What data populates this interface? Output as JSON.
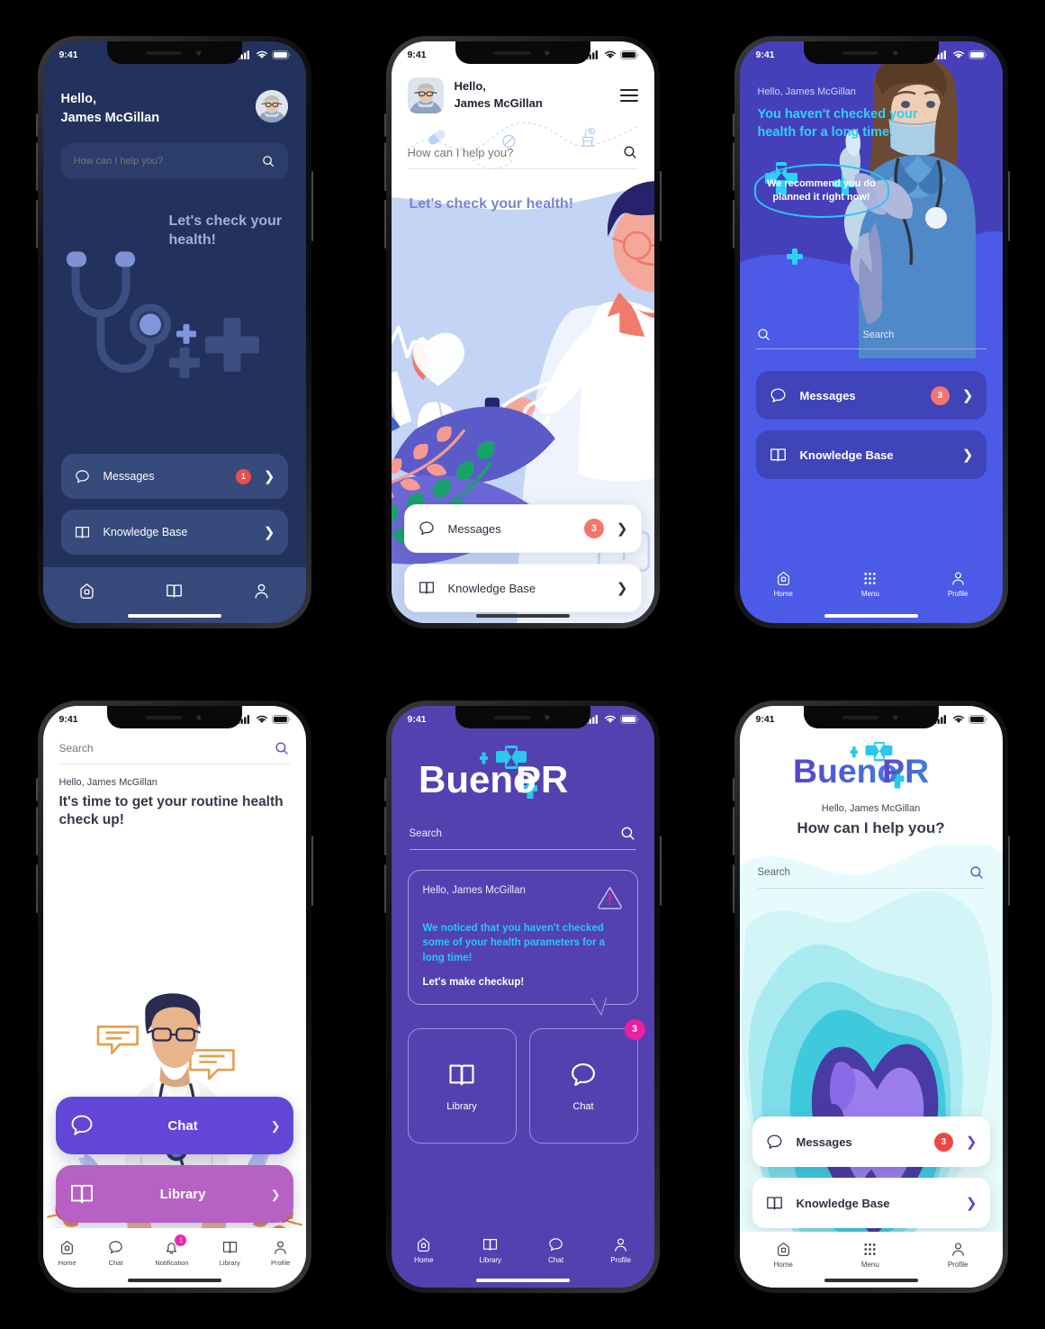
{
  "common": {
    "status_time": "9:41",
    "user_name": "James McGillan"
  },
  "colors": {
    "navy": "#22325c",
    "indigo": "#4540ba",
    "blue": "#4c5ae8",
    "purple": "#5540b0",
    "violet": "#6246d8",
    "pink": "#ec1f9e",
    "orchid": "#b761c4",
    "cyan": "#29c6f2",
    "red_badge": "#ee4b4b",
    "coral_badge": "#f4756d"
  },
  "screen1": {
    "greeting_line1": "Hello,",
    "greeting_line2": "James McGillan",
    "search_placeholder": "How can I help you?",
    "hero_title": "Let's check your health!",
    "cards": [
      {
        "label": "Messages",
        "badge": "1",
        "icon": "chat-bubble-icon"
      },
      {
        "label": "Knowledge Base",
        "badge": "",
        "icon": "book-icon"
      }
    ],
    "tabs": [
      {
        "label": "",
        "icon": "home-icon"
      },
      {
        "label": "",
        "icon": "book-icon"
      },
      {
        "label": "",
        "icon": "person-icon"
      }
    ]
  },
  "screen2": {
    "greeting_line1": "Hello,",
    "greeting_line2": "James McGillan",
    "search_placeholder": "How can I help you?",
    "hero_title": "Let's check your health!",
    "menu_icon": "hamburger-menu-icon",
    "cards": [
      {
        "label": "Messages",
        "badge": "3",
        "icon": "chat-bubble-icon"
      },
      {
        "label": "Knowledge Base",
        "badge": "",
        "icon": "book-icon"
      }
    ]
  },
  "screen3": {
    "greeting": "Hello, James McGillan",
    "headline": "You haven't checked your health for a long time.",
    "bubble": "We recommend you do planned it right now!",
    "search_placeholder": "Search",
    "cards": [
      {
        "label": "Messages",
        "badge": "3",
        "icon": "chat-bubble-icon"
      },
      {
        "label": "Knowledge Base",
        "badge": "",
        "icon": "book-icon"
      }
    ],
    "tabs": [
      {
        "label": "Home",
        "icon": "home-icon"
      },
      {
        "label": "Menu",
        "icon": "grid-dots-icon"
      },
      {
        "label": "Profile",
        "icon": "person-icon"
      }
    ]
  },
  "screen4": {
    "search_placeholder": "Search",
    "greeting": "Hello, James McGillan",
    "headline": "It's time to get your routine health check up!",
    "cards": [
      {
        "label": "Chat",
        "icon": "chat-bubble-icon",
        "color": "#6246d8"
      },
      {
        "label": "Library",
        "icon": "book-icon",
        "color": "#b761c4"
      }
    ],
    "tabs": [
      {
        "label": "Home",
        "icon": "home-icon",
        "badge": ""
      },
      {
        "label": "Chat",
        "icon": "chat-bubble-icon",
        "badge": ""
      },
      {
        "label": "Notification",
        "icon": "bell-icon",
        "badge": "1"
      },
      {
        "label": "Library",
        "icon": "book-icon",
        "badge": ""
      },
      {
        "label": "Profile",
        "icon": "person-icon",
        "badge": ""
      }
    ]
  },
  "screen5": {
    "logo_text_1": "Bueno",
    "logo_text_2": "PR",
    "search_placeholder": "Search",
    "note_greeting": "Hello, James McGillan",
    "note_body": "We noticed that you haven't checked some of your health parameters for a long time!",
    "note_cta": "Let's make checkup!",
    "alert_icon": "warning-triangle-icon",
    "tiles": [
      {
        "label": "Library",
        "icon": "book-icon",
        "badge": ""
      },
      {
        "label": "Chat",
        "icon": "chat-bubble-icon",
        "badge": "3"
      }
    ],
    "tabs": [
      {
        "label": "Home",
        "icon": "home-icon"
      },
      {
        "label": "Library",
        "icon": "book-icon"
      },
      {
        "label": "Chat",
        "icon": "chat-bubble-icon"
      },
      {
        "label": "Profile",
        "icon": "person-icon"
      }
    ]
  },
  "screen6": {
    "logo_text_1": "Bueno",
    "logo_text_2": "PR",
    "greeting": "Hello, James McGillan",
    "headline": "How can I help you?",
    "search_placeholder": "Search",
    "cards": [
      {
        "label": "Messages",
        "badge": "3",
        "icon": "chat-bubble-icon"
      },
      {
        "label": "Knowledge Base",
        "badge": "",
        "icon": "book-icon"
      }
    ],
    "tabs": [
      {
        "label": "Home",
        "icon": "home-icon"
      },
      {
        "label": "Menu",
        "icon": "grid-dots-icon"
      },
      {
        "label": "Profile",
        "icon": "person-icon"
      }
    ]
  }
}
